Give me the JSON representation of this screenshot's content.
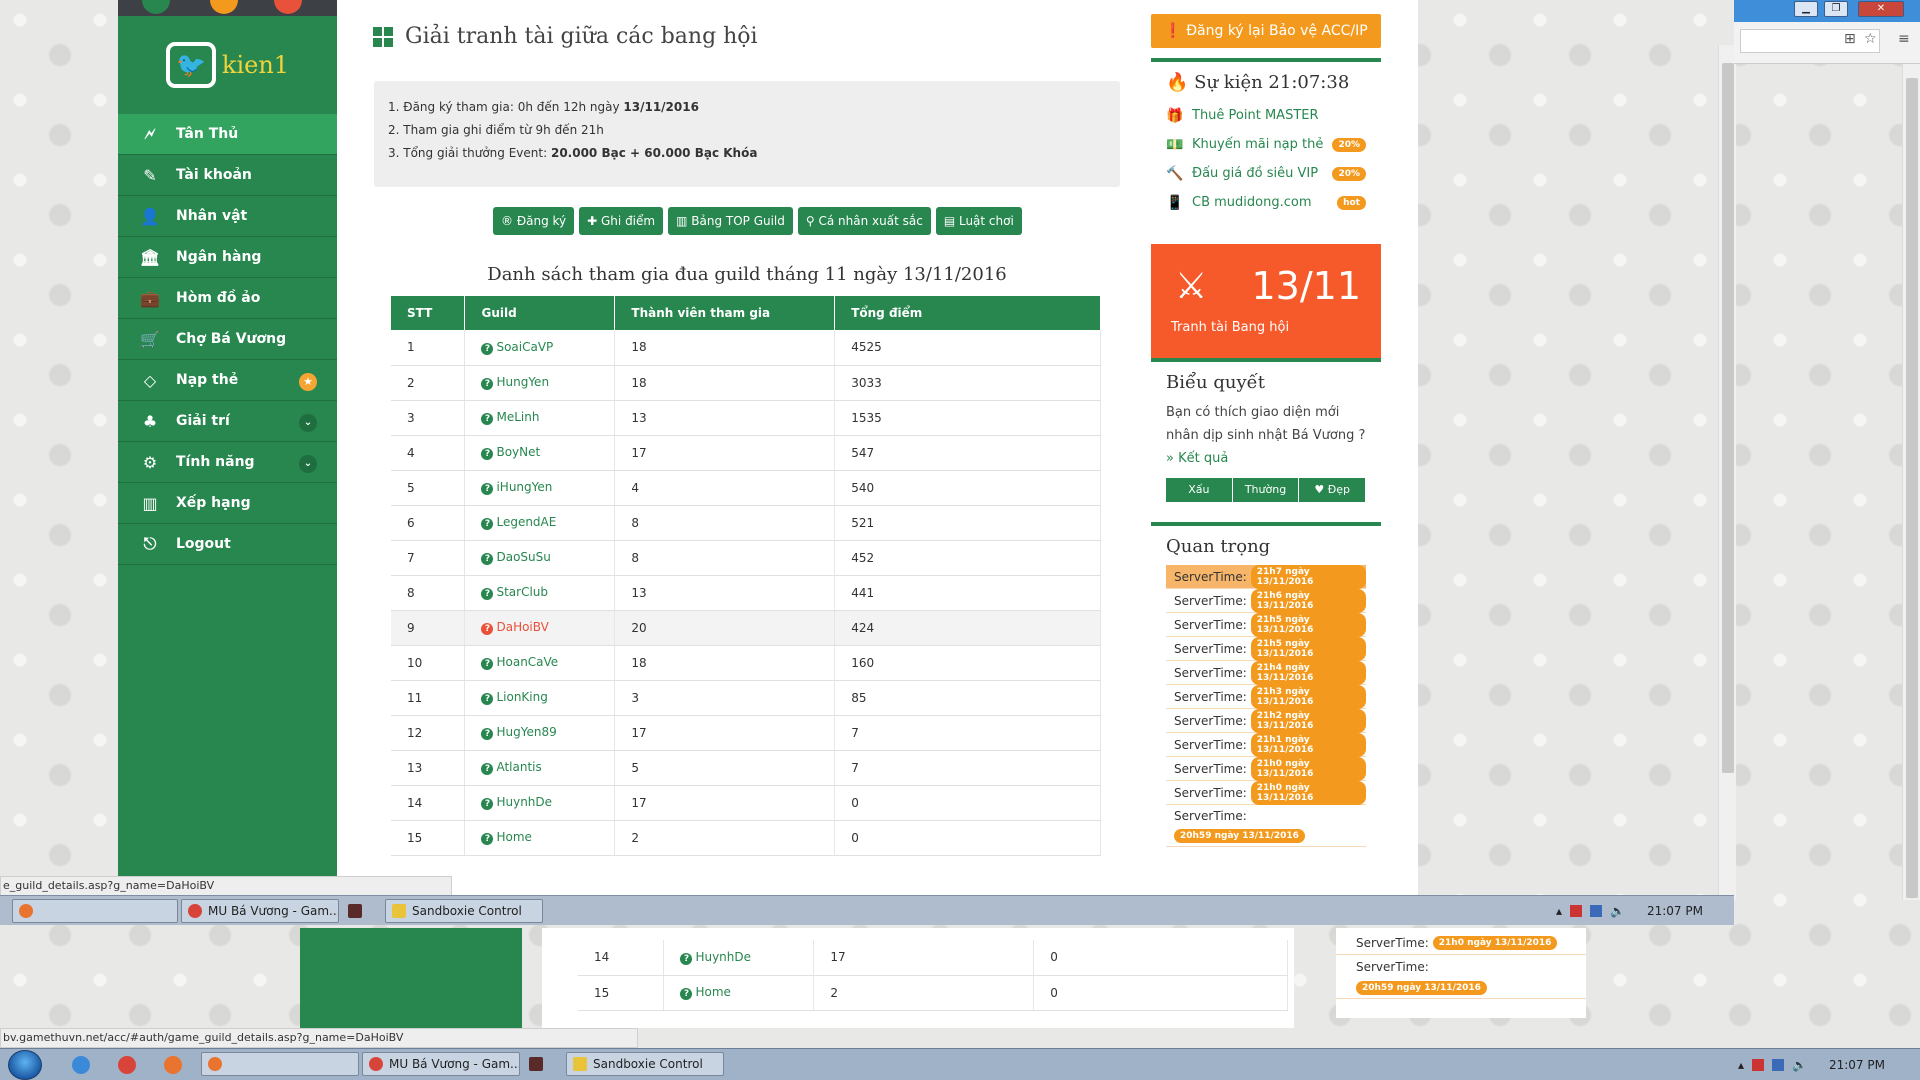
{
  "sidebar": {
    "username": "kien1",
    "items": [
      {
        "label": "Tân Thủ",
        "icon": "🗲",
        "active": true
      },
      {
        "label": "Tài khoản",
        "icon": "✎"
      },
      {
        "label": "Nhân vật",
        "icon": "👤"
      },
      {
        "label": "Ngân hàng",
        "icon": "🏛"
      },
      {
        "label": "Hòm đồ ảo",
        "icon": "💼"
      },
      {
        "label": "Chợ Bá Vương",
        "icon": "🛒"
      },
      {
        "label": "Nạp thẻ",
        "icon": "◇"
      },
      {
        "label": "Giải trí",
        "icon": "♣"
      },
      {
        "label": "Tính năng",
        "icon": "⚙"
      },
      {
        "label": "Xếp hạng",
        "icon": "▥"
      },
      {
        "label": "Logout",
        "icon": "⎋"
      }
    ]
  },
  "main": {
    "title": "Giải tranh tài giữa các bang hội",
    "info": {
      "line1_prefix": "1. Đăng ký tham gia: 0h đến 12h ngày ",
      "line1_bold": "13/11/2016",
      "line2": "2. Tham gia ghi điểm từ 9h đến 21h",
      "line3_prefix": "3. Tổng giải thưởng Event: ",
      "line3_bold": "20.000 Bạc + 60.000 Bạc Khóa"
    },
    "buttons": [
      "® Đăng ký",
      "✚ Ghi điểm",
      "▥ Bảng TOP Guild",
      "⚲ Cá nhân xuất sắc",
      "▤ Luật chơi"
    ],
    "list_title": "Danh sách tham gia đua guild tháng 11 ngày 13/11/2016",
    "table_headers": [
      "STT",
      "Guild",
      "Thành viên tham gia",
      "Tổng điểm"
    ],
    "rows": [
      {
        "stt": "1",
        "guild": "SoaiCaVP",
        "members": "18",
        "points": "4525"
      },
      {
        "stt": "2",
        "guild": "HungYen",
        "members": "18",
        "points": "3033"
      },
      {
        "stt": "3",
        "guild": "MeLinh",
        "members": "13",
        "points": "1535"
      },
      {
        "stt": "4",
        "guild": "BoyNet",
        "members": "17",
        "points": "547"
      },
      {
        "stt": "5",
        "guild": "iHungYen",
        "members": "4",
        "points": "540"
      },
      {
        "stt": "6",
        "guild": "LegendAE",
        "members": "8",
        "points": "521"
      },
      {
        "stt": "7",
        "guild": "DaoSuSu",
        "members": "8",
        "points": "452"
      },
      {
        "stt": "8",
        "guild": "StarClub",
        "members": "13",
        "points": "441"
      },
      {
        "stt": "9",
        "guild": "DaHoiBV",
        "members": "20",
        "points": "424",
        "highlight": true
      },
      {
        "stt": "10",
        "guild": "HoanCaVe",
        "members": "18",
        "points": "160"
      },
      {
        "stt": "11",
        "guild": "LionKing",
        "members": "3",
        "points": "85"
      },
      {
        "stt": "12",
        "guild": "HugYen89",
        "members": "17",
        "points": "7"
      },
      {
        "stt": "13",
        "guild": "Atlantis",
        "members": "5",
        "points": "7"
      },
      {
        "stt": "14",
        "guild": "HuynhDe",
        "members": "17",
        "points": "0"
      },
      {
        "stt": "15",
        "guild": "Home",
        "members": "2",
        "points": "0"
      }
    ]
  },
  "right": {
    "top_button": "Đăng ký lại Bảo vệ ACC/IP",
    "events_title": "Sự kiện 21:07:38",
    "events": [
      {
        "label": "Thuê Point MASTER",
        "icon": "🎁"
      },
      {
        "label": "Khuyến mãi nạp thẻ",
        "icon": "💵",
        "badge": "20%"
      },
      {
        "label": "Đấu giá đồ siêu VIP",
        "icon": "🔨",
        "badge": "20%"
      },
      {
        "label": "CB mudidong.com",
        "icon": "📱",
        "badge": "hot"
      }
    ],
    "card": {
      "date": "13/11",
      "caption": "Tranh tài Bang hội"
    },
    "poll_title": "Biểu quyết",
    "poll_text": "Bạn có thích giao diện mới nhân dịp sinh nhật Bá Vương ? ",
    "poll_link": "» Kết quả",
    "poll_options": [
      "Xấu",
      "Thường",
      "♥ Đẹp"
    ],
    "important_title": "Quan trọng",
    "servertime_label": "ServerTime:",
    "servertimes": [
      "21h7 ngày 13/11/2016",
      "21h6 ngày 13/11/2016",
      "21h5 ngày 13/11/2016",
      "21h5 ngày 13/11/2016",
      "21h4 ngày 13/11/2016",
      "21h3 ngày 13/11/2016",
      "21h2 ngày 13/11/2016",
      "21h1 ngày 13/11/2016",
      "21h0 ngày 13/11/2016",
      "21h0 ngày 13/11/2016"
    ],
    "servertime_last": "20h59 ngày 13/11/2016"
  },
  "status_urls": {
    "inner": "e_guild_details.asp?g_name=DaHoiBV",
    "outer": "bv.gamethuvn.net/acc/#auth/game_guild_details.asp?g_name=DaHoiBV"
  },
  "taskbar_inner": {
    "tasks": [
      "",
      "MU Bá Vương - Gam...",
      "",
      "Sandboxie Control"
    ],
    "time": "21:07 PM"
  },
  "taskbar_outer": {
    "tasks": [
      "",
      "MU Bá Vương - Gam...",
      "",
      "Sandboxie Control"
    ],
    "time": "21:07 PM"
  },
  "lower_rows": [
    {
      "stt": "14",
      "guild": "HuynhDe",
      "members": "17",
      "points": "0"
    },
    {
      "stt": "15",
      "guild": "Home",
      "members": "2",
      "points": "0"
    }
  ],
  "lower_servertime": "21h0 ngày 13/11/2016",
  "colors": {
    "green": "#27874f",
    "orange": "#f39a1e",
    "red_card": "#f75a2a"
  }
}
